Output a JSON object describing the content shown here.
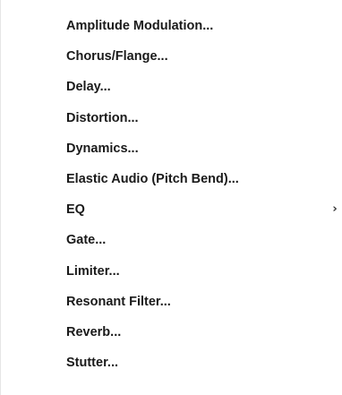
{
  "menu": {
    "items": [
      {
        "label": "Amplitude Modulation...",
        "has_submenu": false
      },
      {
        "label": "Chorus/Flange...",
        "has_submenu": false
      },
      {
        "label": "Delay...",
        "has_submenu": false
      },
      {
        "label": "Distortion...",
        "has_submenu": false
      },
      {
        "label": "Dynamics...",
        "has_submenu": false
      },
      {
        "label": "Elastic Audio (Pitch Bend)...",
        "has_submenu": false
      },
      {
        "label": "EQ",
        "has_submenu": true,
        "submenu_icon": "chevron-right-icon",
        "submenu_glyph": "›"
      },
      {
        "label": "Gate...",
        "has_submenu": false
      },
      {
        "label": "Limiter...",
        "has_submenu": false
      },
      {
        "label": "Resonant Filter...",
        "has_submenu": false
      },
      {
        "label": "Reverb...",
        "has_submenu": false
      },
      {
        "label": "Stutter...",
        "has_submenu": false
      }
    ]
  },
  "colors": {
    "background": "#ffffff",
    "text": "#1a1a1a"
  }
}
